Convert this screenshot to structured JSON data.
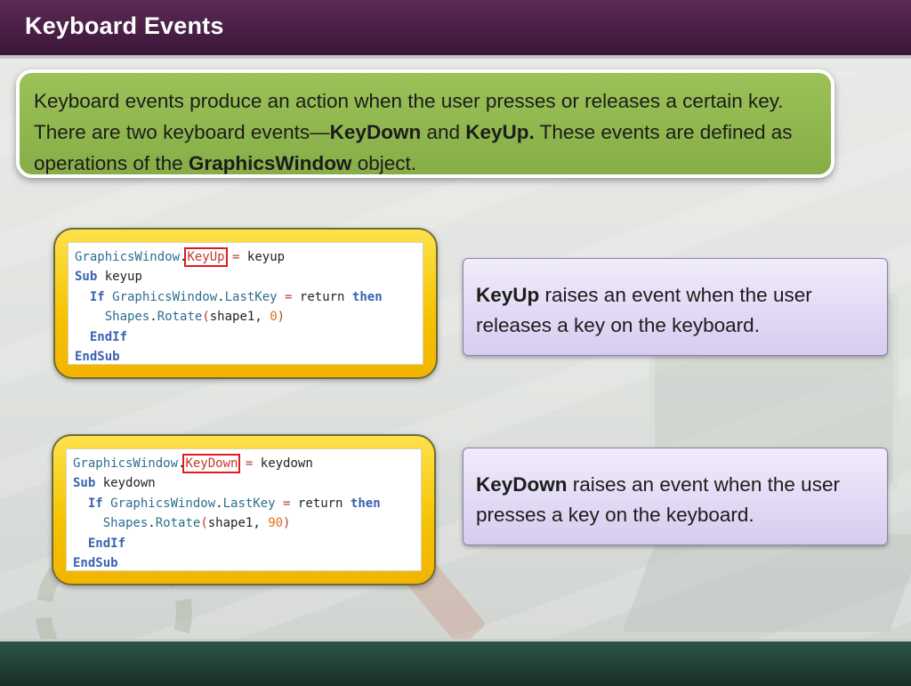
{
  "header": {
    "title": "Keyboard Events"
  },
  "intro": {
    "t1": "Keyboard events produce an action when the user presses or releases a certain key. There are two keyboard events—",
    "b1": "KeyDown",
    "t2": " and ",
    "b2": "KeyUp.",
    "t3": " These events are defined as operations of the ",
    "b3": "GraphicsWindow",
    "t4": " object."
  },
  "code_keyup": {
    "l1_obj": "GraphicsWindow",
    "l1_dot": ".",
    "l1_evt": "KeyUp",
    "l1_eq": " = ",
    "l1_handler": "keyup",
    "l2_kw": "Sub",
    "l2_name": " keyup",
    "l3_kw": "If",
    "l3_obj": " GraphicsWindow",
    "l3_dot": ".",
    "l3_prop": "LastKey",
    "l3_eq": " = ",
    "l3_val": "return ",
    "l3_then": "then",
    "l4_obj": "Shapes",
    "l4_dot": ".",
    "l4_method": "Rotate",
    "l4_open": "(",
    "l4_arg": "shape1, ",
    "l4_num": "0",
    "l4_close": ")",
    "l5_kw": "EndIf",
    "l6_kw": "EndSub"
  },
  "code_keydown": {
    "l1_obj": "GraphicsWindow",
    "l1_dot": ".",
    "l1_evt": "KeyDown",
    "l1_eq": " = ",
    "l1_handler": "keydown",
    "l2_kw": "Sub",
    "l2_name": " keydown",
    "l3_kw": "If",
    "l3_obj": " GraphicsWindow",
    "l3_dot": ".",
    "l3_prop": "LastKey",
    "l3_eq": " = ",
    "l3_val": "return ",
    "l3_then": "then",
    "l4_obj": "Shapes",
    "l4_dot": ".",
    "l4_method": "Rotate",
    "l4_open": "(",
    "l4_arg": "shape1, ",
    "l4_num": "90",
    "l4_close": ")",
    "l5_kw": "EndIf",
    "l6_kw": "EndSub"
  },
  "desc_keyup": {
    "bold": "KeyUp",
    "text": " raises an event when the user releases a key on the keyboard."
  },
  "desc_keydown": {
    "bold": "KeyDown",
    "text": " raises an event when the user presses a key on the keyboard."
  },
  "colors": {
    "header_bg": "#4a1f46",
    "intro_bg": "#8fb64d",
    "code_card_bg": "#f6c400",
    "desc_bg": "#e0d8f4",
    "highlight_box": "#e01b1b",
    "footer_bg": "#24423a"
  }
}
